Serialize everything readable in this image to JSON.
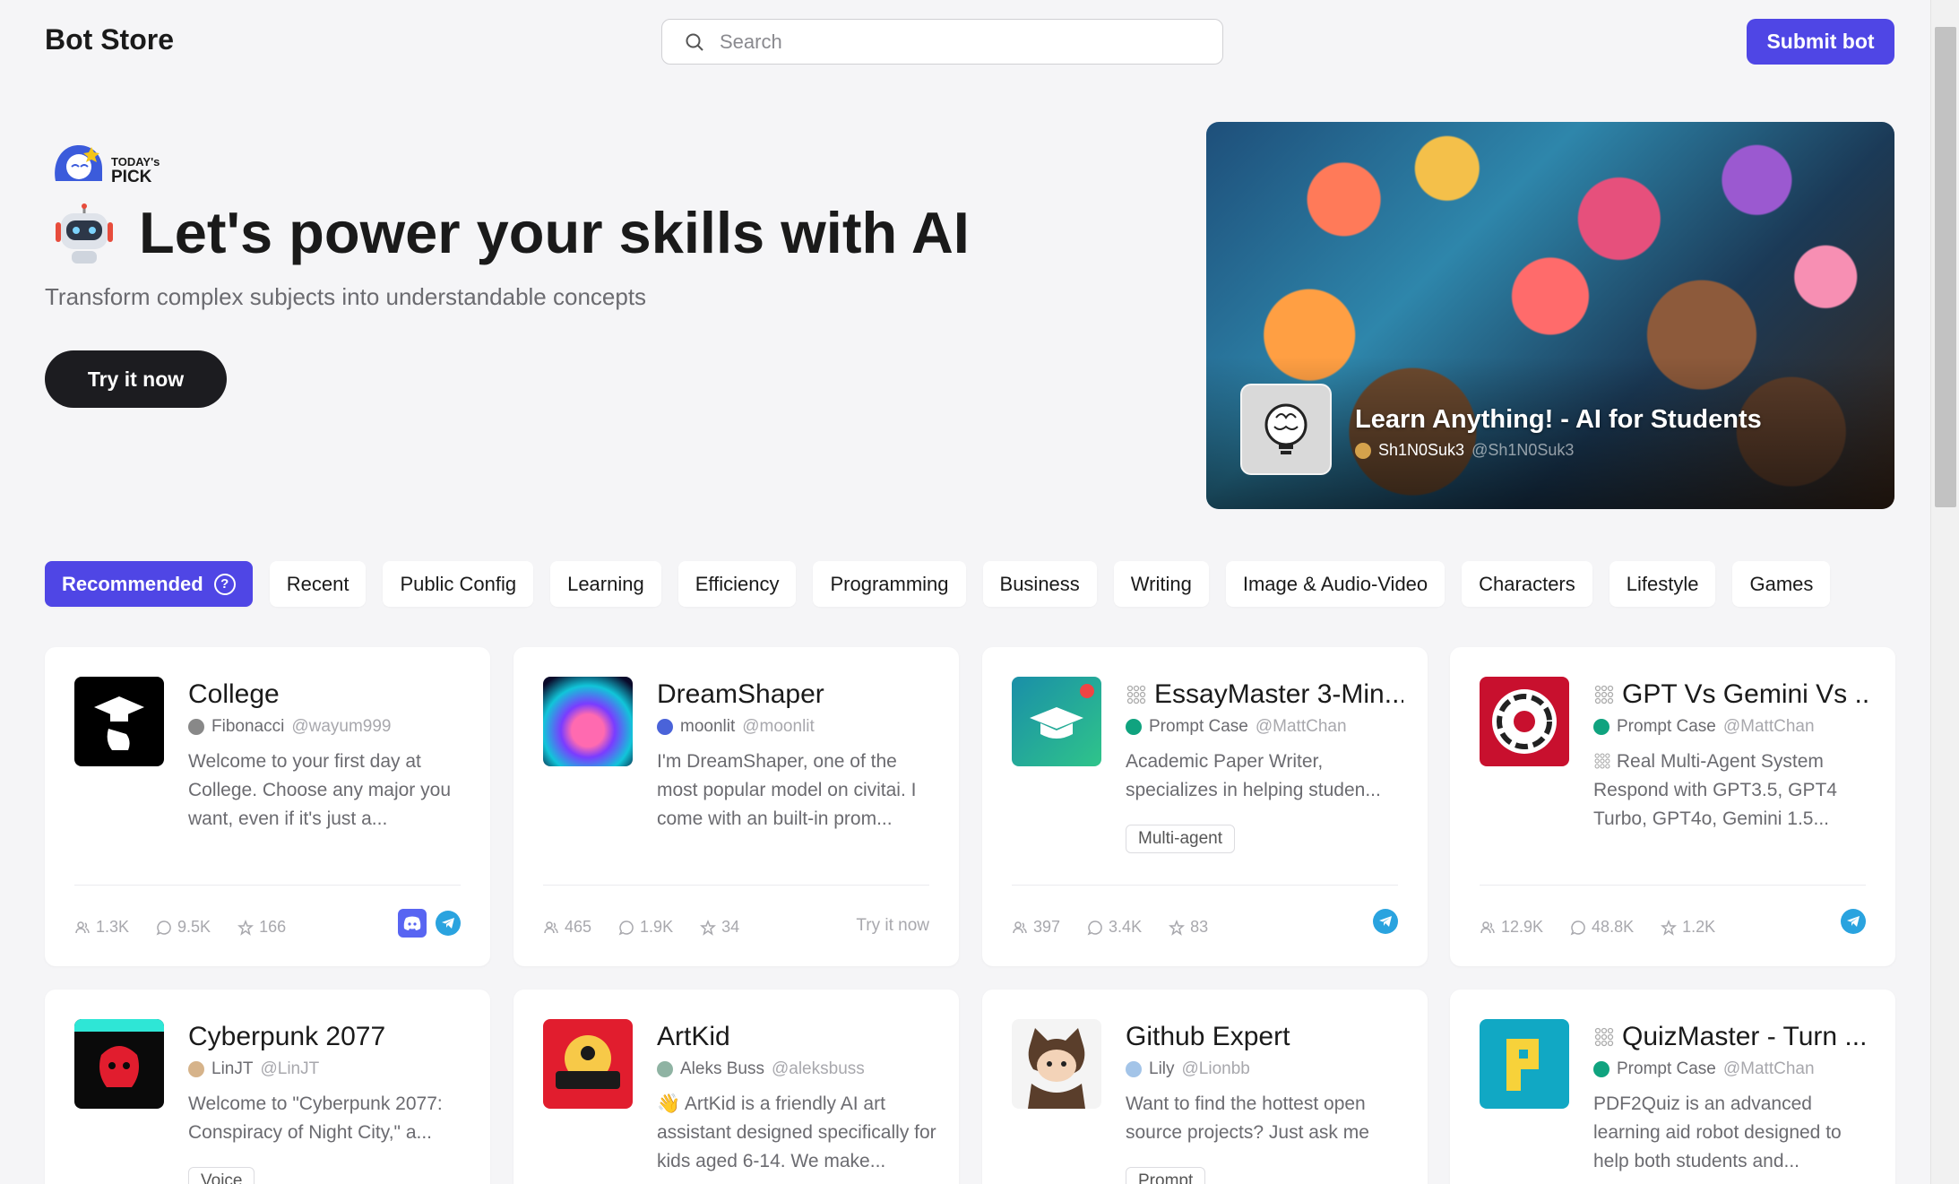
{
  "header": {
    "brand": "Bot Store",
    "search_placeholder": "Search",
    "submit_label": "Submit bot"
  },
  "hero": {
    "badge_line1": "TODAY's",
    "badge_line2": "PICK",
    "title": "Let's power your skills with AI",
    "subtitle": "Transform complex subjects into understandable concepts",
    "cta_label": "Try it now"
  },
  "featured": {
    "title": "Learn Anything! - AI for Students",
    "author": "Sh1N0Suk3",
    "handle": "@Sh1N0Suk3"
  },
  "tabs": [
    {
      "label": "Recommended",
      "active": true
    },
    {
      "label": "Recent"
    },
    {
      "label": "Public Config"
    },
    {
      "label": "Learning"
    },
    {
      "label": "Efficiency"
    },
    {
      "label": "Programming"
    },
    {
      "label": "Business"
    },
    {
      "label": "Writing"
    },
    {
      "label": "Image & Audio-Video"
    },
    {
      "label": "Characters"
    },
    {
      "label": "Lifestyle"
    },
    {
      "label": "Games"
    }
  ],
  "cards": [
    {
      "title": "College",
      "author": "Fibonacci",
      "handle": "@wayum999",
      "desc": "Welcome to your first day at College. Choose any major you want, even if it's just a...",
      "users": "1.3K",
      "chats": "9.5K",
      "stars": "166",
      "actions": [
        "discord-icon",
        "telegram-icon"
      ]
    },
    {
      "title": "DreamShaper",
      "author": "moonlit",
      "handle": "@moonlit",
      "desc": "I'm DreamShaper, one of the most popular model on civitai. I come with an built-in prom...",
      "users": "465",
      "chats": "1.9K",
      "stars": "34",
      "try_label": "Try it now"
    },
    {
      "title": "EssayMaster 3-Min...",
      "author": "Prompt Case",
      "handle": "@MattChan",
      "desc": "Academic Paper Writer, specializes in helping studen...",
      "tag": "Multi-agent",
      "users": "397",
      "chats": "3.4K",
      "stars": "83",
      "actions": [
        "telegram-icon"
      ]
    },
    {
      "title": "GPT Vs Gemini Vs ...",
      "author": "Prompt Case",
      "handle": "@MattChan",
      "desc": "Real Multi-Agent System Respond with GPT3.5, GPT4 Turbo, GPT4o, Gemini 1.5...",
      "users": "12.9K",
      "chats": "48.8K",
      "stars": "1.2K",
      "actions": [
        "telegram-icon"
      ]
    },
    {
      "title": "Cyberpunk 2077",
      "author": "LinJT",
      "handle": "@LinJT",
      "desc": "Welcome to \"Cyberpunk 2077: Conspiracy of Night City,\" a...",
      "tag": "Voice"
    },
    {
      "title": "ArtKid",
      "author": "Aleks Buss",
      "handle": "@aleksbuss",
      "desc": "👋 ArtKid is a friendly AI art assistant designed specifically for kids aged 6-14. We make..."
    },
    {
      "title": "Github Expert",
      "author": "Lily",
      "handle": "@Lionbb",
      "desc": "Want to find the hottest open source projects? Just ask me",
      "tag": "Prompt"
    },
    {
      "title": "QuizMaster - Turn ...",
      "author": "Prompt Case",
      "handle": "@MattChan",
      "desc": "PDF2Quiz is an advanced learning aid robot designed to help both students and..."
    }
  ]
}
